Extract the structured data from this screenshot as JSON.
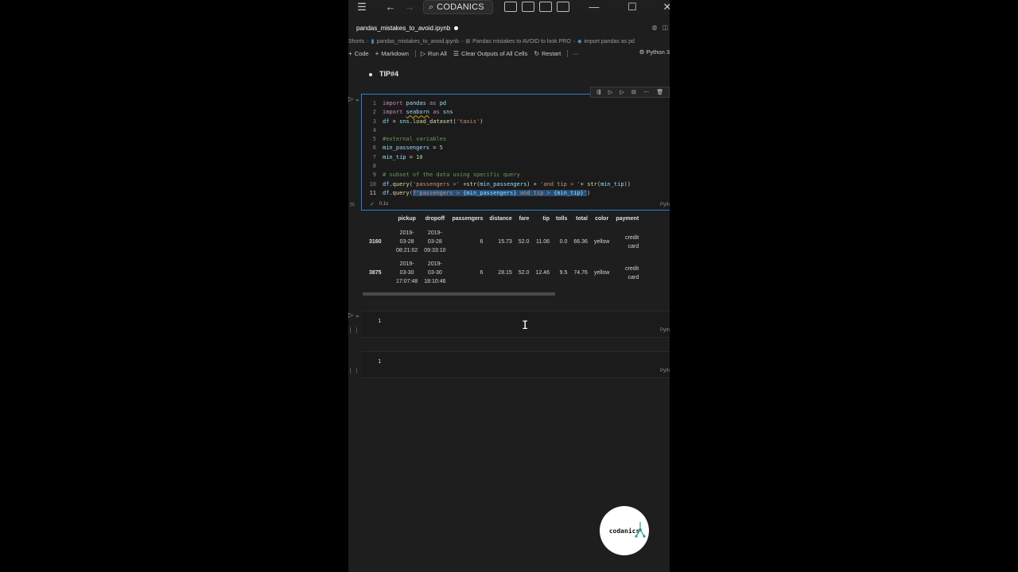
{
  "window": {
    "search_text": "CODANICS",
    "icons": [
      "hamburger-icon",
      "back-arrow-icon",
      "forward-arrow-icon",
      "search-icon",
      "layout-icon",
      "minimize-icon",
      "maximize-icon",
      "close-icon"
    ]
  },
  "tab": {
    "name": "pandas_mistakes_to_avoid.ipynb"
  },
  "breadcrumb": [
    "Shorts",
    "pandas_mistakes_to_avoid.ipynb",
    "Pandas mistakes to AVOID to look PRO",
    "import pandas as pd"
  ],
  "toolbar": {
    "code": "Code",
    "markdown": "Markdown",
    "run_all": "Run All",
    "clear_outputs": "Clear Outputs of All Cells",
    "restart": "Restart",
    "more": "···",
    "kernel": "Python 3"
  },
  "markdown_cell": {
    "text": "TIP#4"
  },
  "code_cell": {
    "lines": [
      "1",
      "2",
      "3",
      "4",
      "5",
      "6",
      "7",
      "8",
      "9",
      "10",
      "11"
    ],
    "exec_time": "0.1s",
    "exec_count": "[5]",
    "language": "Pyth"
  },
  "output": {
    "columns": [
      "pickup",
      "dropoff",
      "passengers",
      "distance",
      "fare",
      "tip",
      "tolls",
      "total",
      "color",
      "payment"
    ],
    "rows": [
      {
        "index": "3160",
        "pickup": [
          "2019-",
          "03-28",
          "08:21:02"
        ],
        "dropoff": [
          "2019-",
          "03-28",
          "09:33:10"
        ],
        "passengers": "6",
        "distance": "15.73",
        "fare": "52.0",
        "tip": "11.06",
        "tolls": "0.0",
        "total": "66.36",
        "color": "yellow",
        "payment": [
          "credit",
          "card"
        ]
      },
      {
        "index": "3875",
        "pickup": [
          "2019-",
          "03-30",
          "17:07:48"
        ],
        "dropoff": [
          "2019-",
          "03-30",
          "18:10:46"
        ],
        "passengers": "6",
        "distance": "28.15",
        "fare": "52.0",
        "tip": "12.46",
        "tolls": "9.5",
        "total": "74.76",
        "color": "yellow",
        "payment": [
          "credit",
          "card"
        ]
      }
    ]
  },
  "empty_cells": [
    {
      "line": "1",
      "language": "Pyth",
      "bracket": "[ ]"
    },
    {
      "line": "1",
      "language": "Pyth",
      "bracket": "[ ]"
    }
  ],
  "logo": {
    "text": "codanics"
  }
}
